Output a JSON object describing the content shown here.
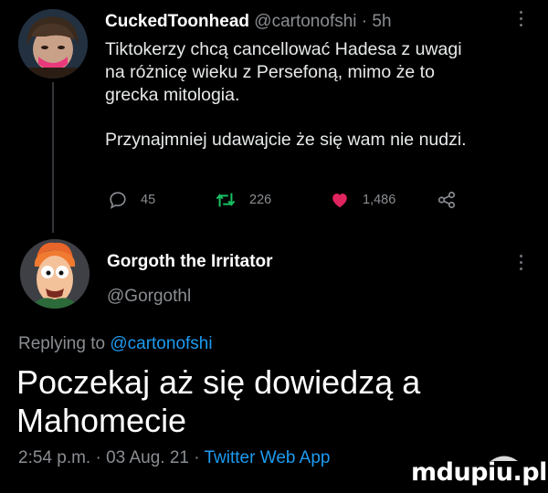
{
  "tweet1": {
    "author_name": "CuckedToonhead",
    "author_handle": "@cartonofshi",
    "separator": " · ",
    "age": "5h",
    "body_lines": [
      "Tiktokerzy chcą cancellować Hadesa z uwagi",
      "na różnicę wieku z Persefoną, mimo że to",
      "grecka mitologia."
    ],
    "body_second_paragraph": "Przynajmniej udawajcie że się wam nie nudzi.",
    "actions": {
      "replies": "45",
      "retweets": "226",
      "likes": "1,486"
    },
    "colors": {
      "retweet_icon": "#17bf63",
      "like_icon": "#e0245e"
    },
    "avatar_icon": "cartoon-character-avatar"
  },
  "tweet2": {
    "author_name": "Gorgoth the Irritator",
    "author_handle": "@Gorgothl",
    "replying_prefix": "Replying to ",
    "replying_to": "@cartonofshi",
    "text_lines": [
      "Poczekaj aż się dowiedzą a",
      "Mahomecie"
    ],
    "timestamp": "2:54 p.m. · 03 Aug. 21 · ",
    "source_app": "Twitter Web App",
    "avatar_icon": "muppet-beaker-avatar"
  },
  "watermark": "mdupiu.pl",
  "theme": {
    "background": "#000000",
    "secondary_text": "#8a8d91",
    "link": "#1d9bf0"
  }
}
